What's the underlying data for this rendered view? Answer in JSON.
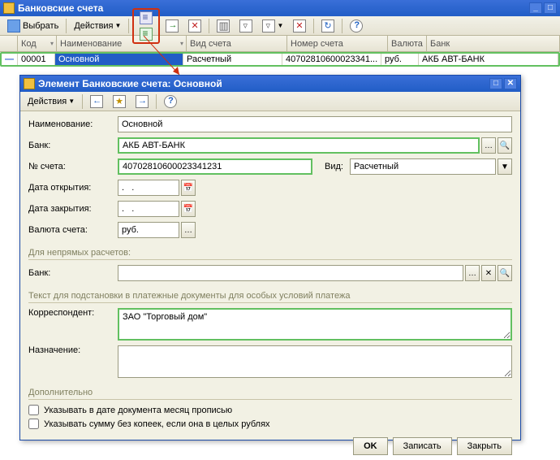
{
  "main": {
    "title": "Банковские счета",
    "toolbar": {
      "select": "Выбрать",
      "actions": "Действия"
    },
    "columns": {
      "mark": "",
      "code": "Код",
      "name": "Наименование",
      "type": "Вид счета",
      "number": "Номер счета",
      "currency": "Валюта",
      "bank": "Банк"
    },
    "row": {
      "mark": "—",
      "code": "00001",
      "name": "Основной",
      "type": "Расчетный",
      "number": "40702810600023341...",
      "currency": "руб.",
      "bank": "АКБ АВТ-БАНК"
    }
  },
  "child": {
    "title": "Элемент Банковские счета: Основной",
    "toolbar": {
      "actions": "Действия"
    },
    "labels": {
      "name": "Наименование:",
      "bank": "Банк:",
      "account": "№ счета:",
      "kind": "Вид:",
      "open": "Дата открытия:",
      "close": "Дата закрытия:",
      "currency": "Валюта счета:",
      "indirect_section": "Для непрямых расчетов:",
      "indirect_bank": "Банк:",
      "subst_section": "Текст для подстановки в платежные документы для особых условий платежа",
      "corr": "Корреспондент:",
      "purpose": "Назначение:",
      "extra_section": "Дополнительно",
      "chk_month": "Указывать в дате документа месяц прописью",
      "chk_sum": "Указывать сумму без копеек, если она в целых рублях"
    },
    "values": {
      "name": "Основной",
      "bank": "АКБ АВТ-БАНК",
      "account": "40702810600023341231",
      "kind": "Расчетный",
      "open": ".   .",
      "close": ".   .",
      "currency": "руб.",
      "indirect_bank": "",
      "corr": "ЗАО \"Торговый дом\"",
      "purpose": "",
      "chk_month": false,
      "chk_sum": false
    },
    "buttons": {
      "ok": "OK",
      "save": "Записать",
      "close": "Закрыть"
    }
  }
}
